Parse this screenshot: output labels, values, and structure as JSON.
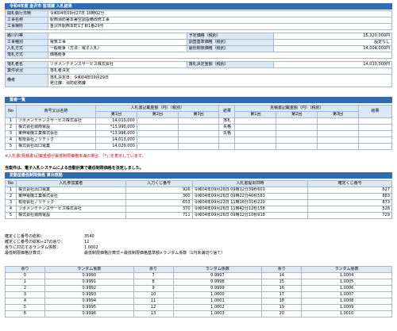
{
  "header": {
    "title": "令和4年度 金沢市 監理課 入札結果"
  },
  "info": {
    "open_label": "開札執行日時",
    "open_value": "令和04年09月27日 10時02分",
    "name_label": "工事名称",
    "name_value": "駅西消防署本署空調設備改修工事",
    "place_label": "工事場所",
    "place_value": "金沢市駅西本町1丁目1番29号",
    "period_label": "路川川等",
    "period_value": "",
    "type_label": "工事種別",
    "type_value": "電気工事",
    "method_label": "入札方式",
    "method_value": "一般競争（方法：電子入札）",
    "grade_label": "落札方式",
    "grade_value": "価格競争",
    "winner_label": "落札者名",
    "winner_value": "ツボメンテナンスサービス株式会社",
    "status_label": "業件状況",
    "status_value": "落札者決定",
    "remarks_label": "備考",
    "remarks_1": "落札決定日：令和04年09月29日",
    "remarks_2": "発注課：消防総務課",
    "r_planned_label": "予定価格（税別）",
    "r_planned_value": "15,320,000円",
    "r_survey_label": "調査基準価格（税別）",
    "r_survey_value": "設定なし",
    "r_min_label": "最低制限価格（税別）",
    "r_min_value": "14,004,000円",
    "r_award_label": "落札決定金額（税別）",
    "r_award_value": "14,010,000円"
  },
  "bidders": {
    "section_title": "業者一覧",
    "col_no": "No",
    "col_name": "商号又は名称",
    "col_amount_group": "入札書記載金額（円）（税別）",
    "col_result": "結果",
    "col_estimate_group": "見積書記載金額（円）（税別）",
    "col_result2": "結果",
    "round1": "第1回",
    "round2": "第2回",
    "round3": "第3回",
    "rows": [
      {
        "no": "1",
        "name": "ツボメンテナンスサービス株式会社",
        "r1": "14,010,000",
        "result": "落札"
      },
      {
        "no": "2",
        "name": "株式会社城南電設",
        "r1": "*13,990,000",
        "result": "失格"
      },
      {
        "no": "3",
        "name": "東伸電機工業株式会社",
        "r1": "*13,996,000",
        "result": "失格"
      },
      {
        "no": "4",
        "name": "有限会社ノリテック",
        "r1": "14,013,000",
        "result": ""
      },
      {
        "no": "5",
        "name": "株式会社出口電業",
        "r1": "14,029,000",
        "result": ""
      }
    ],
    "note": "※入札書(見積書)記載金額が最低制限価格未満の場合、「*」を表示しています。"
  },
  "calc": {
    "intro": "当案件は、電子入札システムによる自動計算で最低制限価格を決定しました。",
    "band": "変動型最低制限価格 算出根拠",
    "col_no": "No",
    "col_name": "入札参加業者",
    "col_entry": "入力くじ番号",
    "col_time": "入札書提出日時",
    "col_decided": "確定くじ番号",
    "rows": [
      {
        "no": "1",
        "name": "株式会社出口電業",
        "entry": "926",
        "time": "令和04年09月26日 09時12分39秒601",
        "decided": "527"
      },
      {
        "no": "2",
        "name": "東伸電機工業株式会社",
        "entry": "300",
        "time": "令和04年09月26日 09時22分40秒583",
        "decided": "883"
      },
      {
        "no": "3",
        "name": "有限会社ノリテック",
        "entry": "653",
        "time": "令和04年09月22日 11時16分31秒220",
        "decided": "873"
      },
      {
        "no": "4",
        "name": "ツボメンテナンスサービス株式会社",
        "entry": "370",
        "time": "令和04年09月26日 11時42分12秒158",
        "decided": "528"
      },
      {
        "no": "5",
        "name": "株式会社城南電設",
        "entry": "711",
        "time": "令和04年09月26日 09時12分10秒918",
        "decided": "729"
      }
    ]
  },
  "summary": {
    "sum_label": "確定くじ番号の総和：",
    "sum_value": "3540",
    "div_label": "確定くじ番号の総和÷27の余り：",
    "div_value": "12",
    "coef_label": "余りに対応するランダム係数：",
    "coef_value": "1.0002",
    "formula_label": "最低制限価格計算式：",
    "formula_value": "最低制限価格計算式＝最低制限価格基準額×ランダム係数（1円未満切り捨て）"
  },
  "random": {
    "h_rem": "余り",
    "h_coef": "ランダム係数",
    "col1": [
      [
        "0",
        "0.9990"
      ],
      [
        "1",
        "0.9991"
      ],
      [
        "2",
        "0.9992"
      ],
      [
        "3",
        "0.9993"
      ],
      [
        "4",
        "0.9994"
      ],
      [
        "5",
        "0.9995"
      ],
      [
        "6",
        "0.9996"
      ]
    ],
    "col2": [
      [
        "7",
        "0.9997"
      ],
      [
        "8",
        "0.9998"
      ],
      [
        "9",
        "0.9999"
      ],
      [
        "10",
        "1.0000"
      ],
      [
        "11",
        "1.0001"
      ],
      [
        "12",
        "1.0002"
      ],
      [
        "13",
        "1.0003"
      ]
    ],
    "col3": [
      [
        "14",
        "1.0004"
      ],
      [
        "15",
        "1.0005"
      ],
      [
        "16",
        "1.0006"
      ],
      [
        "17",
        "1.0007"
      ],
      [
        "18",
        "1.0008"
      ],
      [
        "19",
        "1.0009"
      ],
      [
        "20",
        "1.0010"
      ]
    ]
  }
}
